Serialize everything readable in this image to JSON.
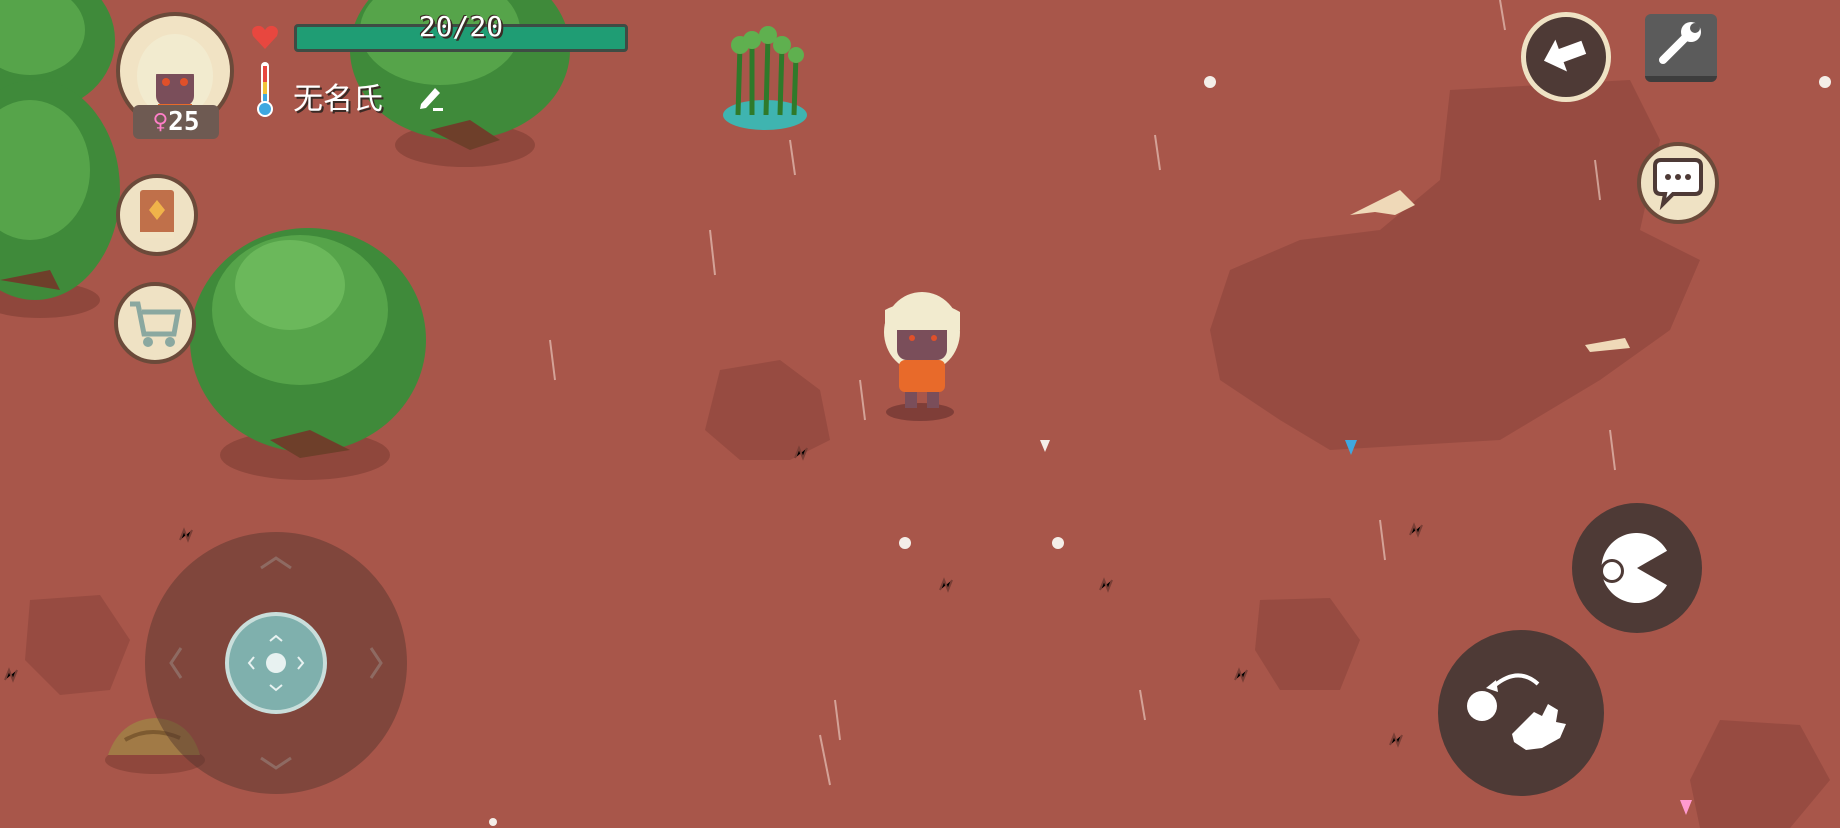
{
  "hud": {
    "health": "20/20",
    "health_fraction": 1.0,
    "player_name": "无名氏",
    "gender_symbol": "♀",
    "age": "25",
    "icons": [
      "heart-icon",
      "thermometer-icon",
      "pencil-icon",
      "book-icon",
      "cart-icon",
      "back-arrow-icon",
      "wrench-icon",
      "chat-icon",
      "eat-icon",
      "throw-icon"
    ]
  },
  "colors": {
    "ground": "#a8564a",
    "health_bar": "#1f9d74",
    "button_dark": "#4e3a36",
    "button_light": "#efe2c4",
    "tree": "#3f8a3a"
  }
}
